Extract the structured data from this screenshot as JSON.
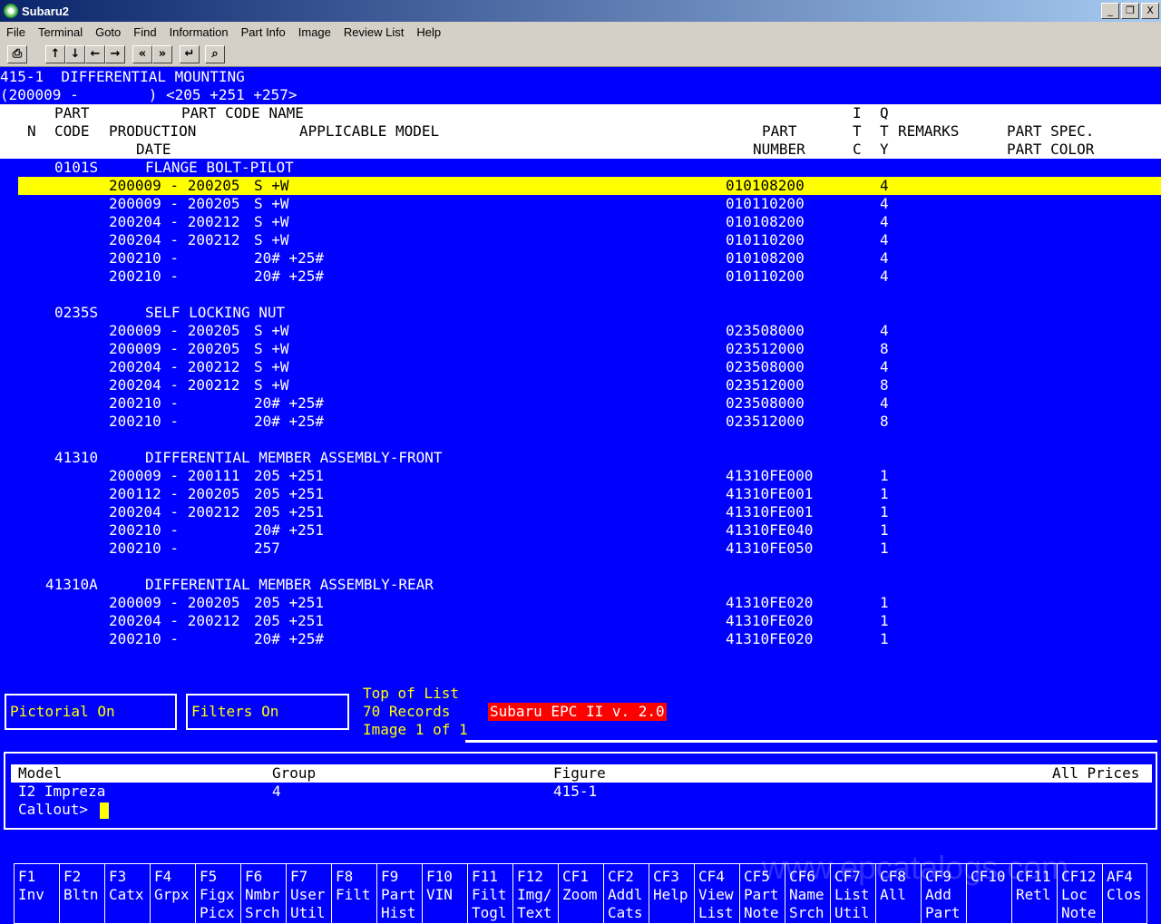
{
  "window": {
    "title": "Subaru2",
    "buttons": [
      "_",
      "❐",
      "X"
    ]
  },
  "menu": [
    "File",
    "Terminal",
    "Goto",
    "Find",
    "Information",
    "Part Info",
    "Image",
    "Review List",
    "Help"
  ],
  "toolbar": {
    "icons": [
      "printer-icon",
      "arrow-up-icon",
      "arrow-down-icon",
      "arrow-left-icon",
      "arrow-right-icon",
      "double-left-icon",
      "double-right-icon",
      "enter-icon",
      "search-icon"
    ],
    "glyphs": [
      "⎙",
      "↑",
      "↓",
      "←",
      "→",
      "«",
      "»",
      "↵",
      "⌕"
    ]
  },
  "header": {
    "line1": "415-1  DIFFERENTIAL MOUNTING",
    "line2": "(200009 -        ) <205 +251 +257>"
  },
  "columns": {
    "part": "PART",
    "part_code_name": "PART CODE NAME",
    "itc_i": "I",
    "qty_q": "Q",
    "n": "N",
    "code": "CODE",
    "production": "PRODUCTION",
    "applicable_model": "APPLICABLE MODEL",
    "part2": "PART",
    "itc_t": "T",
    "qty_t": "T",
    "remarks": "REMARKS",
    "part_spec": "PART SPEC.",
    "date": "DATE",
    "number": "NUMBER",
    "itc_c": "C",
    "qty_y": "Y",
    "part_color": "PART COLOR"
  },
  "groups": [
    {
      "code": "0101S",
      "name": "FLANGE BOLT-PILOT",
      "rows": [
        {
          "prod": "200009 - 200205",
          "model": "S +W",
          "part": "010108200",
          "qty": "4"
        },
        {
          "prod": "200009 - 200205",
          "model": "S +W",
          "part": "010110200",
          "qty": "4"
        },
        {
          "prod": "200204 - 200212",
          "model": "S +W",
          "part": "010108200",
          "qty": "4"
        },
        {
          "prod": "200204 - 200212",
          "model": "S +W",
          "part": "010110200",
          "qty": "4"
        },
        {
          "prod": "200210 -",
          "model": "20# +25#",
          "part": "010108200",
          "qty": "4"
        },
        {
          "prod": "200210 -",
          "model": "20# +25#",
          "part": "010110200",
          "qty": "4"
        }
      ]
    },
    {
      "code": "0235S",
      "name": "SELF LOCKING NUT",
      "rows": [
        {
          "prod": "200009 - 200205",
          "model": "S +W",
          "part": "023508000",
          "qty": "4"
        },
        {
          "prod": "200009 - 200205",
          "model": "S +W",
          "part": "023512000",
          "qty": "8"
        },
        {
          "prod": "200204 - 200212",
          "model": "S +W",
          "part": "023508000",
          "qty": "4"
        },
        {
          "prod": "200204 - 200212",
          "model": "S +W",
          "part": "023512000",
          "qty": "8"
        },
        {
          "prod": "200210 -",
          "model": "20# +25#",
          "part": "023508000",
          "qty": "4"
        },
        {
          "prod": "200210 -",
          "model": "20# +25#",
          "part": "023512000",
          "qty": "8"
        }
      ]
    },
    {
      "code": "41310",
      "name": "DIFFERENTIAL MEMBER ASSEMBLY-FRONT",
      "rows": [
        {
          "prod": "200009 - 200111",
          "model": "205 +251",
          "part": "41310FE000",
          "qty": "1"
        },
        {
          "prod": "200112 - 200205",
          "model": "205 +251",
          "part": "41310FE001",
          "qty": "1"
        },
        {
          "prod": "200204 - 200212",
          "model": "205 +251",
          "part": "41310FE001",
          "qty": "1"
        },
        {
          "prod": "200210 -",
          "model": "20# +251",
          "part": "41310FE040",
          "qty": "1"
        },
        {
          "prod": "200210 -",
          "model": "257",
          "part": "41310FE050",
          "qty": "1"
        }
      ]
    },
    {
      "code": "41310A",
      "name": "DIFFERENTIAL MEMBER ASSEMBLY-REAR",
      "rows": [
        {
          "prod": "200009 - 200205",
          "model": "205 +251",
          "part": "41310FE020",
          "qty": "1"
        },
        {
          "prod": "200204 - 200212",
          "model": "205 +251",
          "part": "41310FE020",
          "qty": "1"
        },
        {
          "prod": "200210 -",
          "model": "20# +25#",
          "part": "41310FE020",
          "qty": "1"
        }
      ]
    }
  ],
  "status": {
    "pictorial": "Pictorial On",
    "filters": "Filters On",
    "top_of_list": "Top of List",
    "records": "70 Records",
    "image": "Image 1 of 1",
    "version": "Subaru EPC II v. 2.0"
  },
  "bottom": {
    "model_label": "Model",
    "group_label": "Group",
    "figure_label": "Figure",
    "prices_label": "All Prices",
    "model_value": "I2 Impreza",
    "group_value": "4",
    "figure_value": "415-1",
    "callout_label": "Callout>"
  },
  "fkeys": [
    {
      "key": "F1",
      "l1": "Inv",
      "l2": ""
    },
    {
      "key": "F2",
      "l1": "Bltn",
      "l2": ""
    },
    {
      "key": "F3",
      "l1": "Catx",
      "l2": ""
    },
    {
      "key": "F4",
      "l1": "Grpx",
      "l2": ""
    },
    {
      "key": "F5",
      "l1": "Figx",
      "l2": "Picx"
    },
    {
      "key": "F6",
      "l1": "Nmbr",
      "l2": "Srch"
    },
    {
      "key": "F7",
      "l1": "User",
      "l2": "Util"
    },
    {
      "key": "F8",
      "l1": "Filt",
      "l2": ""
    },
    {
      "key": "F9",
      "l1": "Part",
      "l2": "Hist"
    },
    {
      "key": "F10",
      "l1": "VIN",
      "l2": ""
    },
    {
      "key": "F11",
      "l1": "Filt",
      "l2": "Togl"
    },
    {
      "key": "F12",
      "l1": "Img/",
      "l2": "Text"
    },
    {
      "key": "CF1",
      "l1": "Zoom",
      "l2": ""
    },
    {
      "key": "CF2",
      "l1": "Addl",
      "l2": "Cats"
    },
    {
      "key": "CF3",
      "l1": "Help",
      "l2": ""
    },
    {
      "key": "CF4",
      "l1": "View",
      "l2": "List"
    },
    {
      "key": "CF5",
      "l1": "Part",
      "l2": "Note"
    },
    {
      "key": "CF6",
      "l1": "Name",
      "l2": "Srch"
    },
    {
      "key": "CF7",
      "l1": "List",
      "l2": "Util"
    },
    {
      "key": "CF8",
      "l1": "All",
      "l2": ""
    },
    {
      "key": "CF9",
      "l1": "Add",
      "l2": "Part"
    },
    {
      "key": "CF10",
      "l1": "",
      "l2": ""
    },
    {
      "key": "CF11",
      "l1": "Retl",
      "l2": ""
    },
    {
      "key": "CF12",
      "l1": "Loc",
      "l2": "Note"
    },
    {
      "key": "AF4",
      "l1": "Clos",
      "l2": ""
    }
  ],
  "watermark": "www.epcatalogs.com"
}
